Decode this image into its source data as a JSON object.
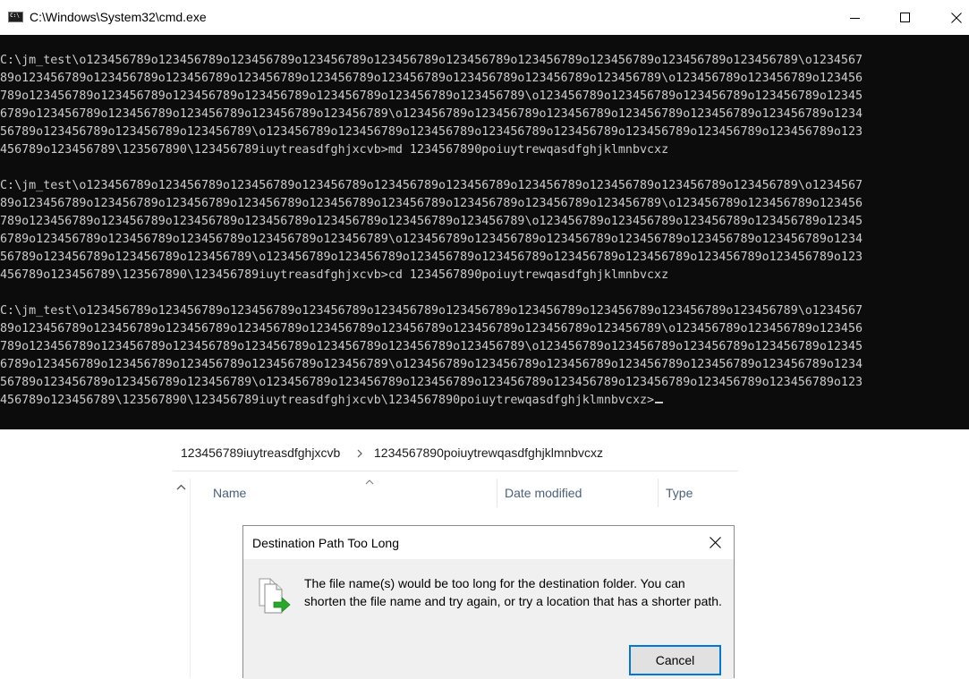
{
  "cmd_window": {
    "title": "C:\\Windows\\System32\\cmd.exe",
    "icon_text": "C:\\",
    "console_lines": [
      "",
      "C:\\jm_test\\o123456789o123456789o123456789o123456789o123456789o123456789o123456789o123456789o123456789o123456789\\o1234567",
      "89o123456789o123456789o123456789o123456789o123456789o123456789o123456789o123456789o123456789\\o123456789o123456789o123456",
      "789o123456789o123456789o123456789o123456789o123456789o123456789o123456789\\o123456789o123456789o123456789o123456789o12345",
      "6789o123456789o123456789o123456789o123456789o123456789\\o123456789o123456789o123456789o123456789o123456789o123456789o1234",
      "56789o123456789o123456789o123456789\\o123456789o123456789o123456789o123456789o123456789o123456789o123456789o123456789o123",
      "456789o123456789\\123567890\\123456789iuytreasdfghjxcvb>md 1234567890poiuytrewqasdfghjklmnbvcxz",
      "",
      "C:\\jm_test\\o123456789o123456789o123456789o123456789o123456789o123456789o123456789o123456789o123456789o123456789\\o1234567",
      "89o123456789o123456789o123456789o123456789o123456789o123456789o123456789o123456789o123456789\\o123456789o123456789o123456",
      "789o123456789o123456789o123456789o123456789o123456789o123456789o123456789\\o123456789o123456789o123456789o123456789o12345",
      "6789o123456789o123456789o123456789o123456789o123456789\\o123456789o123456789o123456789o123456789o123456789o123456789o1234",
      "56789o123456789o123456789o123456789\\o123456789o123456789o123456789o123456789o123456789o123456789o123456789o123456789o123",
      "456789o123456789\\123567890\\123456789iuytreasdfghjxcvb>cd 1234567890poiuytrewqasdfghjklmnbvcxz",
      "",
      "C:\\jm_test\\o123456789o123456789o123456789o123456789o123456789o123456789o123456789o123456789o123456789o123456789\\o1234567",
      "89o123456789o123456789o123456789o123456789o123456789o123456789o123456789o123456789o123456789\\o123456789o123456789o123456",
      "789o123456789o123456789o123456789o123456789o123456789o123456789o123456789\\o123456789o123456789o123456789o123456789o12345",
      "6789o123456789o123456789o123456789o123456789o123456789\\o123456789o123456789o123456789o123456789o123456789o123456789o1234",
      "56789o123456789o123456789o123456789\\o123456789o123456789o123456789o123456789o123456789o123456789o123456789o123456789o123",
      "456789o123456789\\123567890\\123456789iuytreasdfghjxcvb\\1234567890poiuytrewqasdfghjklmnbvcxz>"
    ]
  },
  "explorer": {
    "breadcrumb": [
      "123456789iuytreasdfghjxcvb",
      "1234567890poiuytrewqasdfghjklmnbvcxz"
    ],
    "columns": {
      "name": "Name",
      "date_modified": "Date modified",
      "type": "Type"
    }
  },
  "dialog": {
    "title": "Destination Path Too Long",
    "message": "The file name(s) would be too long for the destination folder. You can shorten the file name and try again, or try a location that has a shorter path.",
    "cancel_label": "Cancel"
  },
  "colors": {
    "console_bg": "#0c0c0c",
    "console_fg": "#cccccc",
    "dialog_bg": "#f0f0f0",
    "button_focus_border": "#0078d7",
    "column_header_text": "#4c607a",
    "copy_arrow_green": "#29a829"
  },
  "icons": {
    "window_minimize": "minimize-icon",
    "window_maximize": "maximize-icon",
    "window_close": "close-icon",
    "breadcrumb_separator": "chevron-right-icon",
    "dialog_file": "file-copy-icon"
  }
}
